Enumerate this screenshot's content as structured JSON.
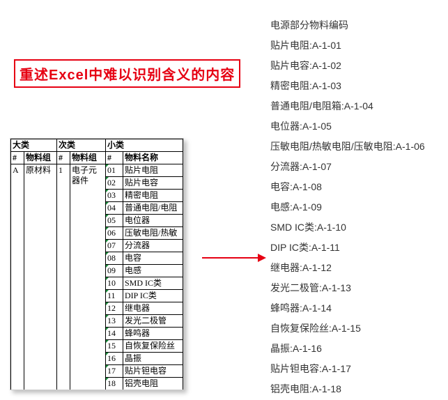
{
  "title": "重述Excel中难以识别含义的内容",
  "table": {
    "group_headers": {
      "major": "大类",
      "minor": "次类",
      "sub": "小类"
    },
    "col_headers": {
      "hash": "#",
      "major_name": "物料组",
      "minor_hash": "#",
      "minor_name": "物料组",
      "sub_hash": "#",
      "sub_name": "物料名称"
    },
    "major_code": "A",
    "major_name": "原材料",
    "minor_code": "1",
    "minor_name_line1": "电子元",
    "minor_name_line2": "器件",
    "sub_rows": [
      {
        "code": "01",
        "name": "贴片电阻"
      },
      {
        "code": "02",
        "name": "贴片电容"
      },
      {
        "code": "03",
        "name": "精密电阻"
      },
      {
        "code": "04",
        "name": "普通电阻/电阻"
      },
      {
        "code": "05",
        "name": "电位器"
      },
      {
        "code": "06",
        "name": "压敏电阻/热敏"
      },
      {
        "code": "07",
        "name": "分流器"
      },
      {
        "code": "08",
        "name": "电容"
      },
      {
        "code": "09",
        "name": "电感"
      },
      {
        "code": "10",
        "name": "SMD IC类"
      },
      {
        "code": "11",
        "name": "DIP IC类"
      },
      {
        "code": "12",
        "name": "继电器"
      },
      {
        "code": "13",
        "name": "发光二极管"
      },
      {
        "code": "14",
        "name": "蜂鸣器"
      },
      {
        "code": "15",
        "name": "自恢复保险丝"
      },
      {
        "code": "16",
        "name": "晶振"
      },
      {
        "code": "17",
        "name": "贴片钽电容"
      },
      {
        "code": "18",
        "name": "铝壳电阻"
      }
    ]
  },
  "right_list": {
    "heading": "电源部分物料编码",
    "items": [
      "贴片电阻:A-1-01",
      "贴片电容:A-1-02",
      "精密电阻:A-1-03",
      "普通电阻/电阻箱:A-1-04",
      "电位器:A-1-05",
      "压敏电阻/热敏电阻/压敏电阻:A-1-06",
      "分流器:A-1-07",
      "电容:A-1-08",
      "电感:A-1-09",
      "SMD IC类:A-1-10",
      "DIP IC类:A-1-11",
      "继电器:A-1-12",
      "发光二极管:A-1-13",
      "蜂鸣器:A-1-14",
      "自恢复保险丝:A-1-15",
      "晶振:A-1-16",
      "贴片钽电容:A-1-17",
      "铝壳电阻:A-1-18"
    ]
  }
}
